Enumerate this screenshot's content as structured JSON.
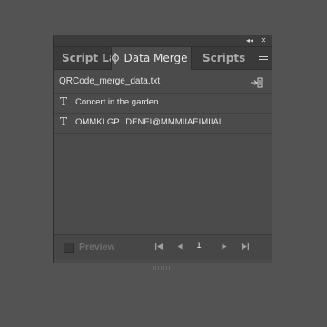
{
  "panel": {
    "titlebar": {
      "collapse_glyph": "◂◂",
      "close_glyph": "✕"
    },
    "tabs": [
      {
        "label": "Script La",
        "active": false
      },
      {
        "label": "Data Merge",
        "active": true
      },
      {
        "label": "Scripts",
        "active": false
      }
    ],
    "menu_icon": "panel-menu-icon",
    "source_file": "QRCode_merge_data.txt",
    "fields": [
      {
        "type_glyph": "T",
        "name": "Concert in the garden"
      },
      {
        "type_glyph": "T",
        "name": "OMMKLGP...DENEI@MMMIIAEIMIIAI"
      }
    ],
    "bottom": {
      "preview_label": "Preview",
      "preview_checked": false,
      "first_glyph": "⏮",
      "prev_glyph": "◀",
      "page": "1",
      "next_glyph": "▶",
      "last_glyph": "⏭"
    }
  }
}
